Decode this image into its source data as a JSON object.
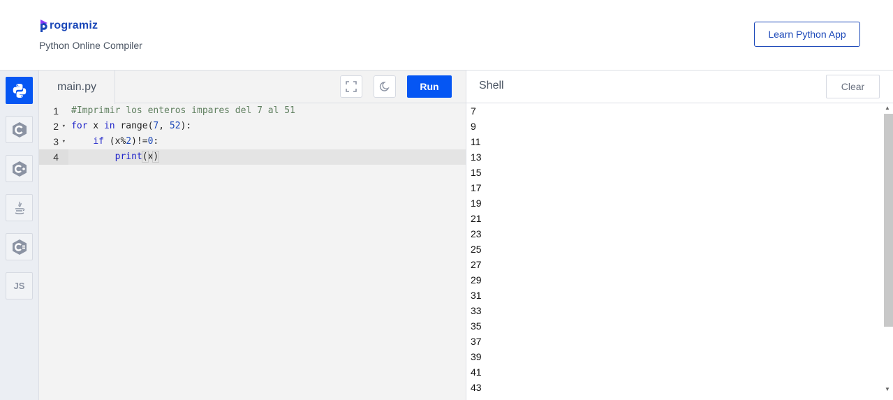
{
  "header": {
    "logo_text": "rogramiz",
    "subtitle": "Python Online Compiler",
    "learn_button": "Learn Python App"
  },
  "sidebar": {
    "languages": [
      {
        "name": "python-icon",
        "active": true
      },
      {
        "name": "c-icon",
        "active": false
      },
      {
        "name": "cpp-icon",
        "active": false
      },
      {
        "name": "java-icon",
        "active": false
      },
      {
        "name": "csharp-icon",
        "active": false
      },
      {
        "name": "javascript-icon",
        "label": "JS",
        "active": false
      }
    ]
  },
  "editor": {
    "file_tab": "main.py",
    "run_label": "Run",
    "lines": [
      {
        "num": "1",
        "text": "#Imprimir los enteros impares del 7 al 51"
      },
      {
        "num": "2",
        "text": "for x in range(7, 52):"
      },
      {
        "num": "3",
        "text": "    if (x%2)!=0:"
      },
      {
        "num": "4",
        "text": "        print(x)"
      }
    ]
  },
  "shell": {
    "title": "Shell",
    "clear_label": "Clear",
    "output": [
      "7",
      "9",
      "11",
      "13",
      "15",
      "17",
      "19",
      "21",
      "23",
      "25",
      "27",
      "29",
      "31",
      "33",
      "35",
      "37",
      "39",
      "41",
      "43"
    ]
  },
  "colors": {
    "accent": "#0556f3",
    "brand": "#1a47b8"
  }
}
